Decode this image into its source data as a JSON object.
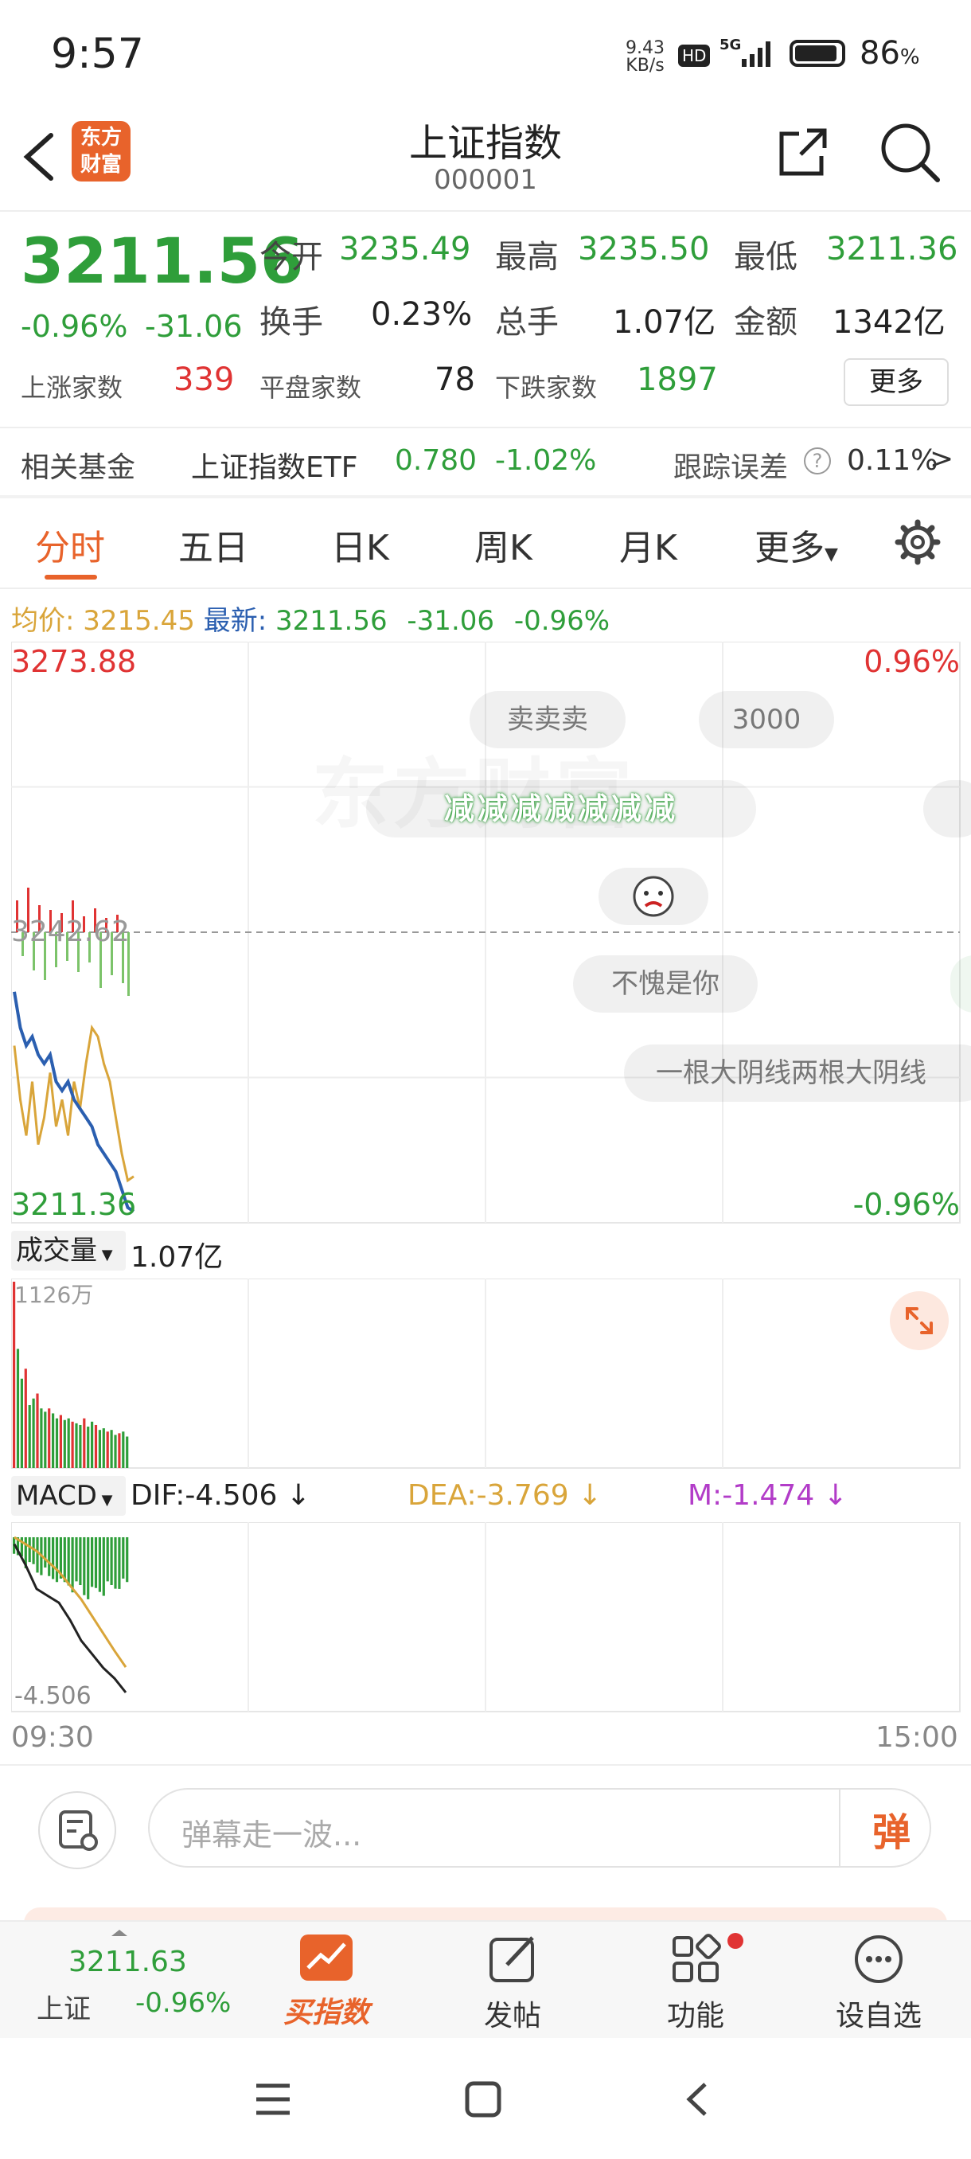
{
  "status": {
    "time": "9:57",
    "net_speed_top": "9.43",
    "net_speed_bottom": "KB/s",
    "hd": "HD",
    "signal": "5G",
    "battery": "86",
    "battery_unit": "%"
  },
  "header": {
    "logo_line1": "东方",
    "logo_line2": "财富",
    "title": "上证指数",
    "code": "000001"
  },
  "quote": {
    "price": "3211.56",
    "change_pct": "-0.96%",
    "change": "-31.06",
    "open_label": "今开",
    "open": "3235.49",
    "high_label": "最高",
    "high": "3235.50",
    "low_label": "最低",
    "low": "3211.36",
    "turnover_label": "换手",
    "turnover": "0.23%",
    "volume_label": "总手",
    "volume": "1.07亿",
    "amount_label": "金额",
    "amount": "1342亿",
    "up_label": "上涨家数",
    "up": "339",
    "flat_label": "平盘家数",
    "flat": "78",
    "down_label": "下跌家数",
    "down": "1897",
    "more_btn": "更多"
  },
  "fund": {
    "label": "相关基金",
    "name": "上证指数ETF",
    "price": "0.780",
    "pct": "-1.02%",
    "track_label": "跟踪误差",
    "track_value": "0.11%",
    "arrow": ">"
  },
  "tabs": [
    "分时",
    "五日",
    "日K",
    "周K",
    "月K",
    "更多"
  ],
  "legend": {
    "avg_label": "均价:",
    "avg": "3215.45",
    "latest_label": "最新:",
    "latest": "3211.56",
    "change": "-31.06",
    "pct": "-0.96%"
  },
  "chart_labels": {
    "top_price": "3273.88",
    "top_pct": "0.96%",
    "mid_price": "3242.62",
    "bottom_price": "3211.36",
    "bottom_pct": "-0.96%"
  },
  "danmaku": [
    "卖卖卖",
    "3000",
    "减减减减减减减",
    "不愧是你",
    "一根大阴线两根大阴线"
  ],
  "watermark": "东方财富",
  "volume_panel": {
    "label": "成交量",
    "total": "1.07亿",
    "max": "1126万"
  },
  "macd_panel": {
    "label": "MACD",
    "dif": "DIF:-4.506",
    "dea": "DEA:-3.769",
    "m": "M:-1.474",
    "min": "-4.506"
  },
  "time_axis": {
    "start": "09:30",
    "end": "15:00"
  },
  "input": {
    "placeholder": "弹幕走一波...",
    "send": "弹"
  },
  "bottom_nav": {
    "index_price": "3211.63",
    "index_name": "上证",
    "index_pct": "-0.96%",
    "buy": "买指数",
    "post": "发帖",
    "func": "功能",
    "watch": "设自选"
  },
  "colors": {
    "up": "#e03333",
    "down": "#2f9e3a",
    "avg": "#d9a53a",
    "price_line": "#2b5fb0",
    "accent": "#e8632b"
  },
  "chart_data": [
    {
      "type": "line",
      "name": "intraday",
      "ylim": [
        3211.36,
        3273.88
      ],
      "prev_close": 3242.62,
      "series": [
        {
          "name": "最新",
          "values": [
            3236,
            3232,
            3230,
            3231,
            3229,
            3228,
            3229,
            3226,
            3225,
            3226,
            3224,
            3223,
            3222,
            3221,
            3219,
            3218,
            3217,
            3216,
            3214,
            3212,
            3211.56
          ]
        },
        {
          "name": "均价",
          "values": [
            3230,
            3224,
            3220,
            3226,
            3219,
            3222,
            3227,
            3221,
            3224,
            3220,
            3226,
            3223,
            3228,
            3232,
            3231,
            3228,
            3226,
            3222,
            3218,
            3215,
            3215.45
          ]
        }
      ]
    },
    {
      "type": "bar",
      "name": "volume",
      "ylim": [
        0,
        1126
      ],
      "values": [
        1126,
        720,
        540,
        600,
        380,
        420,
        450,
        360,
        340,
        360,
        330,
        300,
        320,
        290,
        300,
        280,
        270,
        260,
        300,
        250,
        280,
        260,
        230,
        240,
        220,
        230,
        200,
        210,
        220,
        190
      ]
    },
    {
      "type": "line",
      "name": "macd",
      "ylim": [
        -4.506,
        0.3
      ],
      "series": [
        {
          "name": "DIF",
          "values": [
            -0.2,
            -0.8,
            -1.5,
            -1.7,
            -1.9,
            -2.4,
            -3.0,
            -3.4,
            -3.8,
            -4.1,
            -4.506
          ]
        },
        {
          "name": "DEA",
          "values": [
            0,
            -0.2,
            -0.4,
            -0.7,
            -1.0,
            -1.4,
            -1.8,
            -2.3,
            -2.8,
            -3.3,
            -3.769
          ]
        },
        {
          "name": "M",
          "values": [
            -0.6,
            -0.9,
            -1.1,
            -1.3,
            -1.5,
            -1.6,
            -1.8,
            -1.7,
            -1.6,
            -1.5,
            -1.474
          ]
        }
      ]
    }
  ]
}
